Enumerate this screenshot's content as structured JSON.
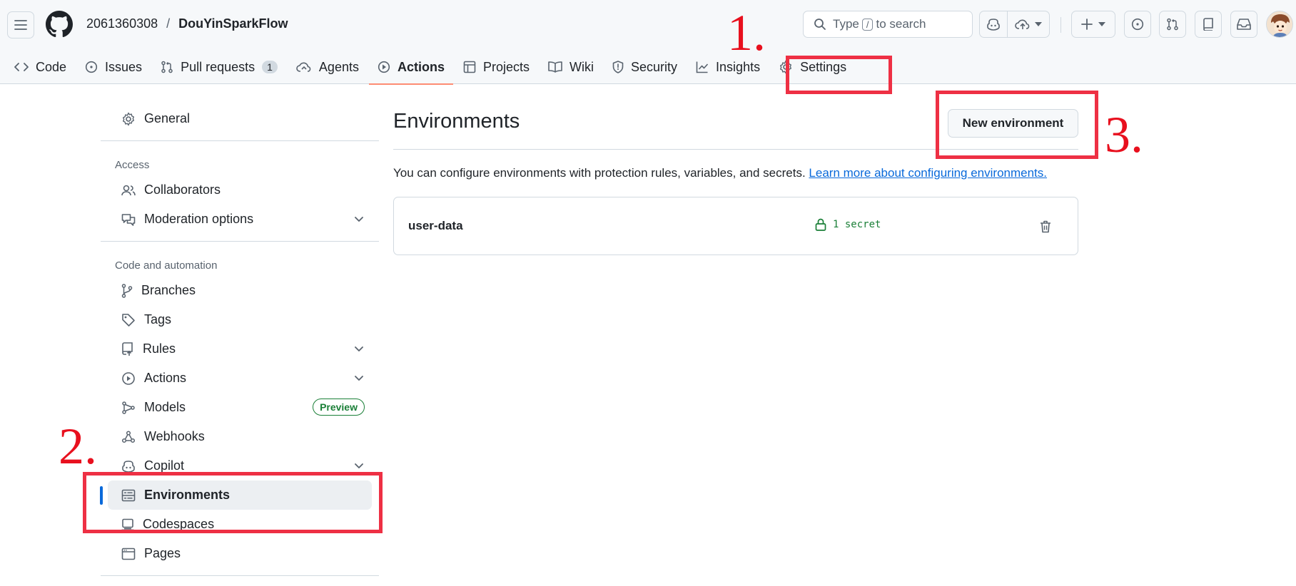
{
  "header": {
    "owner": "2061360308",
    "separator": "/",
    "repo": "DouYinSparkFlow",
    "search": {
      "prefix": "Type",
      "key": "/",
      "suffix": "to search"
    }
  },
  "tabs": [
    {
      "label": "Code"
    },
    {
      "label": "Issues"
    },
    {
      "label": "Pull requests",
      "count": "1"
    },
    {
      "label": "Agents"
    },
    {
      "label": "Actions",
      "selected": true
    },
    {
      "label": "Projects"
    },
    {
      "label": "Wiki"
    },
    {
      "label": "Security"
    },
    {
      "label": "Insights"
    },
    {
      "label": "Settings"
    }
  ],
  "sidebar": {
    "general": "General",
    "access_heading": "Access",
    "collaborators": "Collaborators",
    "moderation": "Moderation options",
    "code_heading": "Code and automation",
    "branches": "Branches",
    "tags": "Tags",
    "rules": "Rules",
    "actions": "Actions",
    "models": "Models",
    "models_badge": "Preview",
    "webhooks": "Webhooks",
    "copilot": "Copilot",
    "environments": "Environments",
    "codespaces": "Codespaces",
    "pages": "Pages"
  },
  "main": {
    "title": "Environments",
    "new_button": "New environment",
    "description": "You can configure environments with protection rules, variables, and secrets.",
    "learn_more": "Learn more about configuring environments.",
    "environments": [
      {
        "name": "user-data",
        "secrets": "1 secret"
      }
    ]
  },
  "annotations": {
    "one": "1.",
    "two": "2.",
    "three": "3."
  },
  "colors": {
    "annotation_red": "#ee3044",
    "accent_blue": "#0969da",
    "success_green": "#1a7f37",
    "tab_underline": "#fd8c73"
  }
}
